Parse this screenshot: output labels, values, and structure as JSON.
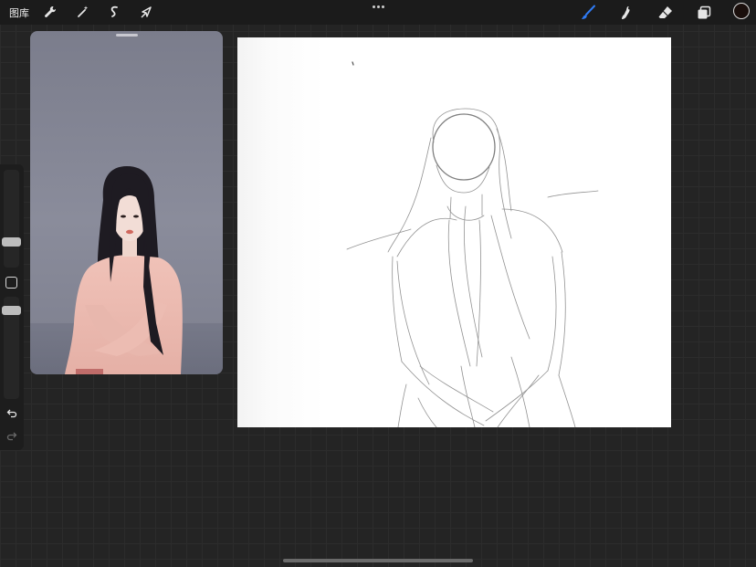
{
  "topbar": {
    "gallery_label": "图库",
    "left_tools": [
      "wrench-icon",
      "magic-wand-icon",
      "selection-icon",
      "transform-arrow-icon"
    ],
    "right_tools": [
      "brush-icon",
      "smudge-icon",
      "eraser-icon",
      "layers-icon"
    ],
    "active_tool": "brush-icon",
    "accent_color": "#2f7bf5",
    "current_color": "#1a0f0c"
  },
  "reference": {
    "description_icon": "reference-photo"
  },
  "sidebar": {
    "brush_size_level": 0.3,
    "opacity_level": 0.6
  }
}
